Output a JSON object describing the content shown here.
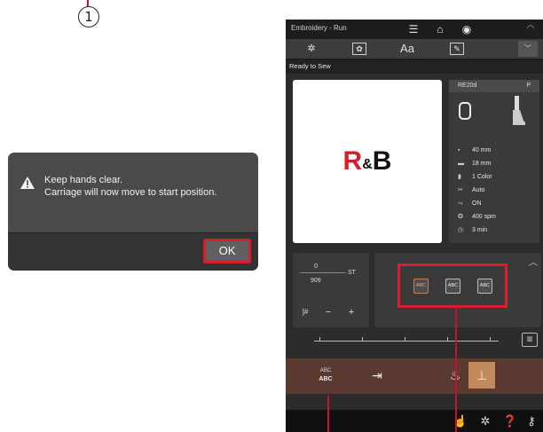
{
  "annotation": {
    "number": "1"
  },
  "dialog": {
    "message": "Keep hands clear.\nCarriage will now move to start position.",
    "ok_label": "OK",
    "warning_icon": "warning-triangle-icon"
  },
  "device": {
    "title": "Embroidery - Run",
    "status": "Ready to Sew",
    "topbar_icons": [
      "menu-icon",
      "home-icon",
      "back-icon",
      "wifi-icon"
    ],
    "tabs": [
      {
        "icon": "embroidery-settings-icon",
        "glyph": "✲"
      },
      {
        "icon": "design-icon",
        "glyph": "✿"
      },
      {
        "label": "Aa"
      },
      {
        "icon": "edit-icon",
        "glyph": "✎"
      }
    ],
    "design": {
      "logo_r": "R",
      "logo_amp": "&",
      "logo_b": "B"
    },
    "info": {
      "hoop": "RE20d",
      "presser_mark": "P",
      "width": "40 mm",
      "height": "18 mm",
      "colors": "1 Color",
      "thread_cut": "Auto",
      "jump": "ON",
      "speed": "400 spm",
      "time": "3 min"
    },
    "counter": {
      "current": "0",
      "total": "909",
      "unit": "ST",
      "minus": "−",
      "plus": "+",
      "jump_label": "]#"
    },
    "positions": [
      "ABC",
      "ABC",
      "ABC"
    ],
    "toolbar": {
      "abc_top": "ABC",
      "abc_bottom": "ABC"
    },
    "bottom_icons": [
      "touch-icon",
      "settings-icon",
      "help-icon",
      "key-icon"
    ]
  }
}
